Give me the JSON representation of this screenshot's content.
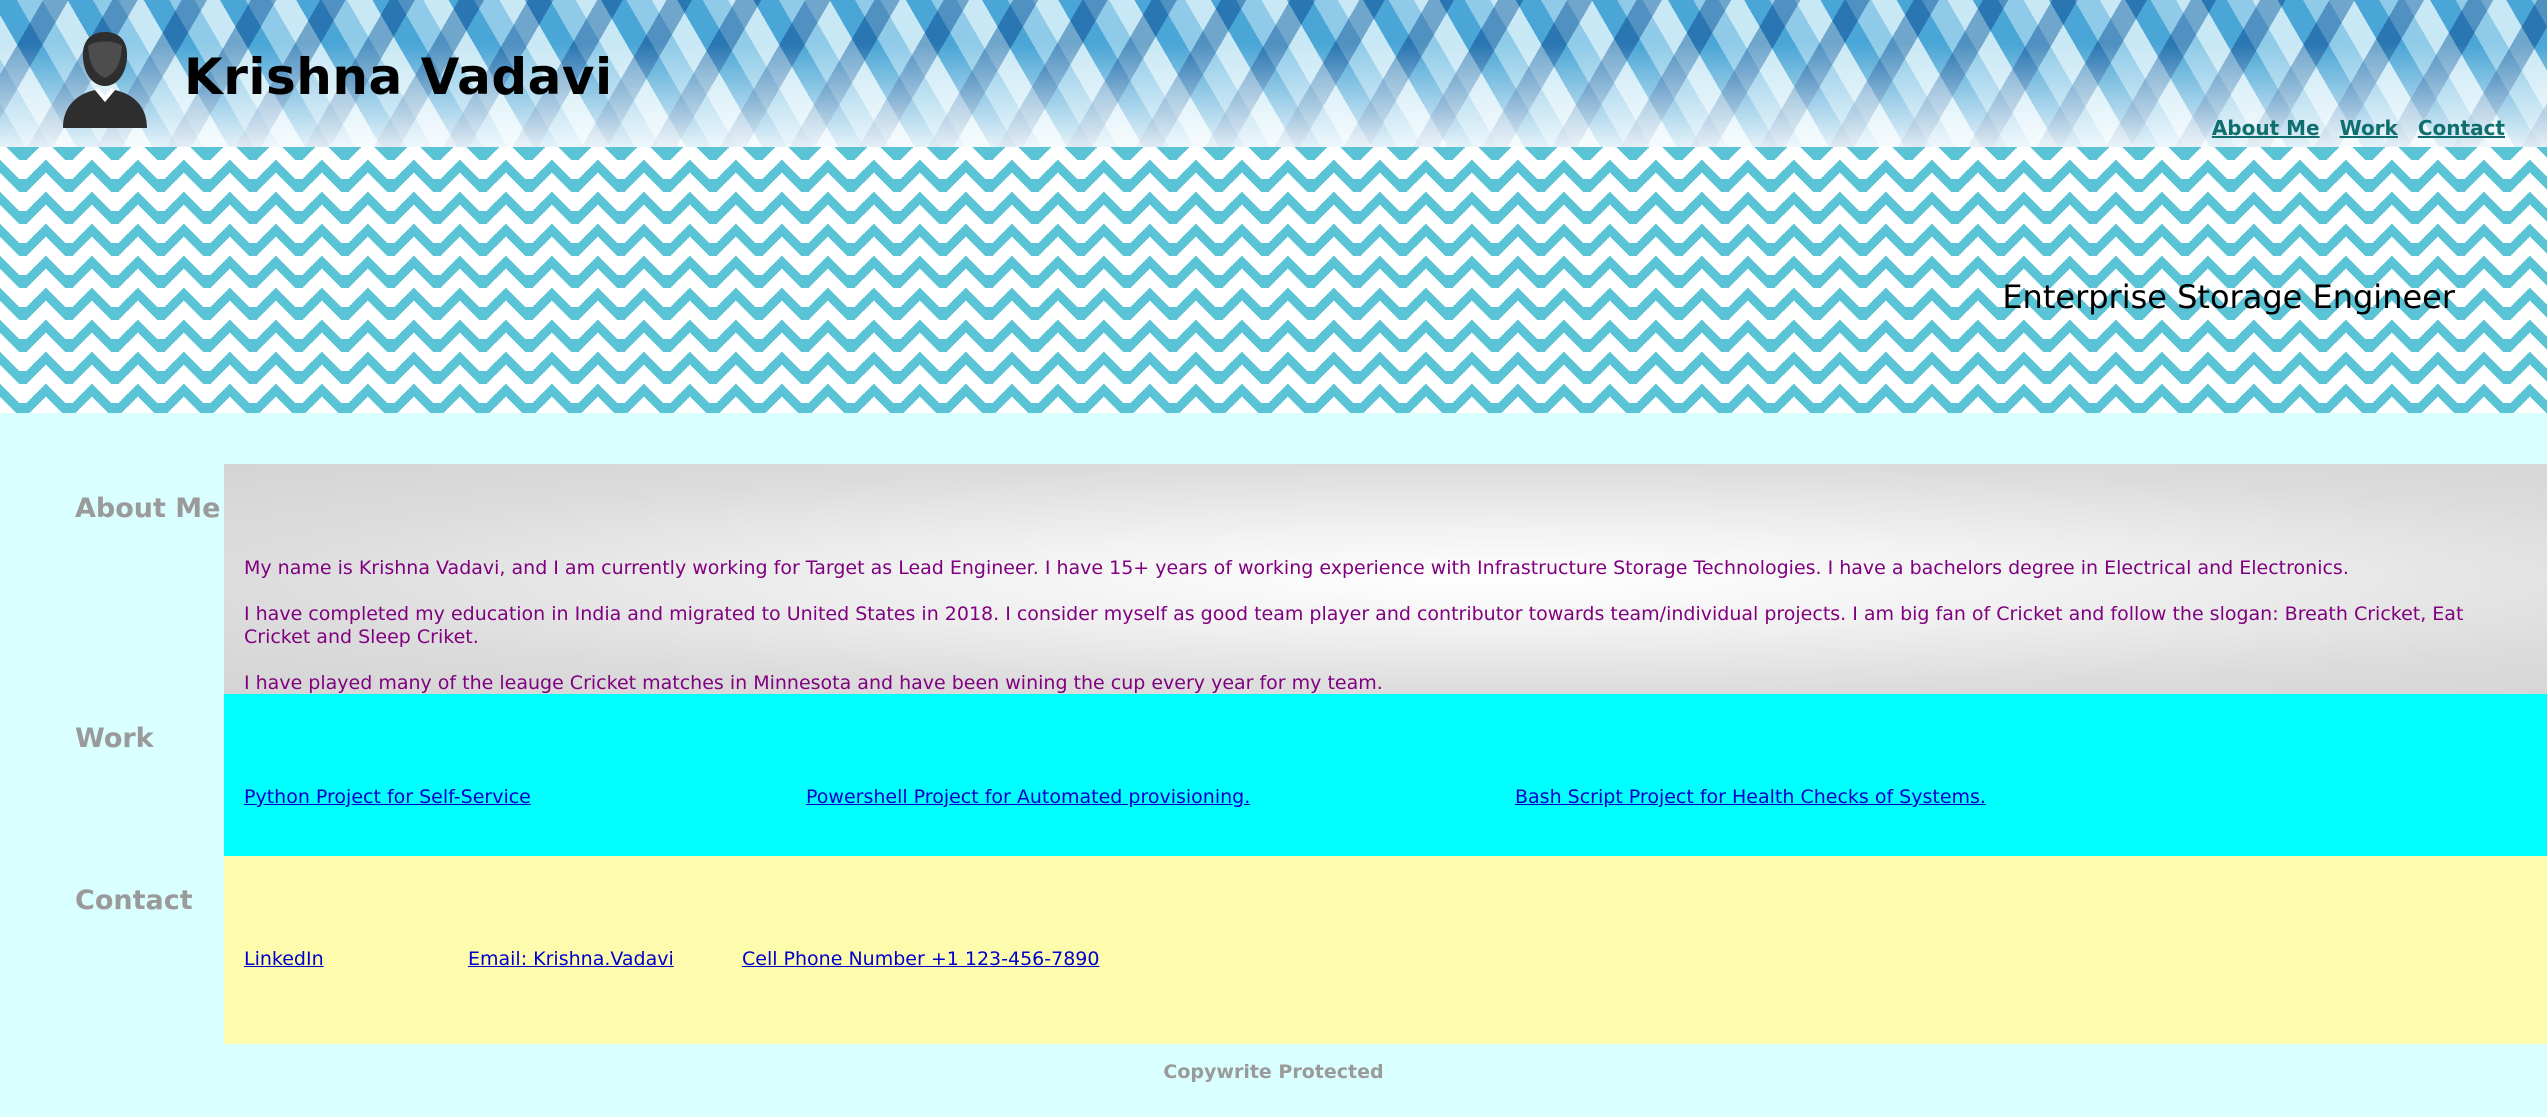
{
  "header": {
    "name": "Krishna Vadavi",
    "nav": [
      "About Me",
      "Work",
      "Contact"
    ]
  },
  "banner": {
    "tagline": "Enterprise Storage Engineer"
  },
  "sections": {
    "about": {
      "label": "About Me",
      "paragraphs": [
        "My name is Krishna Vadavi, and I am currently working for Target as Lead Engineer. I have 15+ years of working experience with Infrastructure Storage Technologies. I have a bachelors degree in Electrical and Electronics.",
        "I have completed my education in India and migrated to United States in 2018. I consider myself as good team player and contributor towards team/individual projects. I am big fan of Cricket and follow the slogan: Breath Cricket, Eat Cricket and Sleep Criket.",
        "I have played many of the leauge Cricket matches in Minnesota and have been wining the cup every year for my team."
      ]
    },
    "work": {
      "label": "Work",
      "links": [
        "Python Project for Self-Service",
        "Powershell Project for Automated provisioning.",
        "Bash Script Project for Health Checks of Systems."
      ]
    },
    "contact": {
      "label": "Contact",
      "links": [
        "LinkedIn",
        "Email: Krishna.Vadavi",
        "Cell Phone Number +1 123-456-7890"
      ]
    }
  },
  "footer": {
    "text": "Copywrite Protected"
  },
  "colors": {
    "page_bg": "#d9ffff",
    "work_bg": "#00ffff",
    "contact_bg": "#fdfcad",
    "about_text": "#800080",
    "link": "#0000cc",
    "nav_link": "#0f6f6f",
    "section_label": "#9a9a9a",
    "chevron": "#5bc3d6"
  },
  "icons": {
    "avatar": "user-avatar-icon"
  }
}
